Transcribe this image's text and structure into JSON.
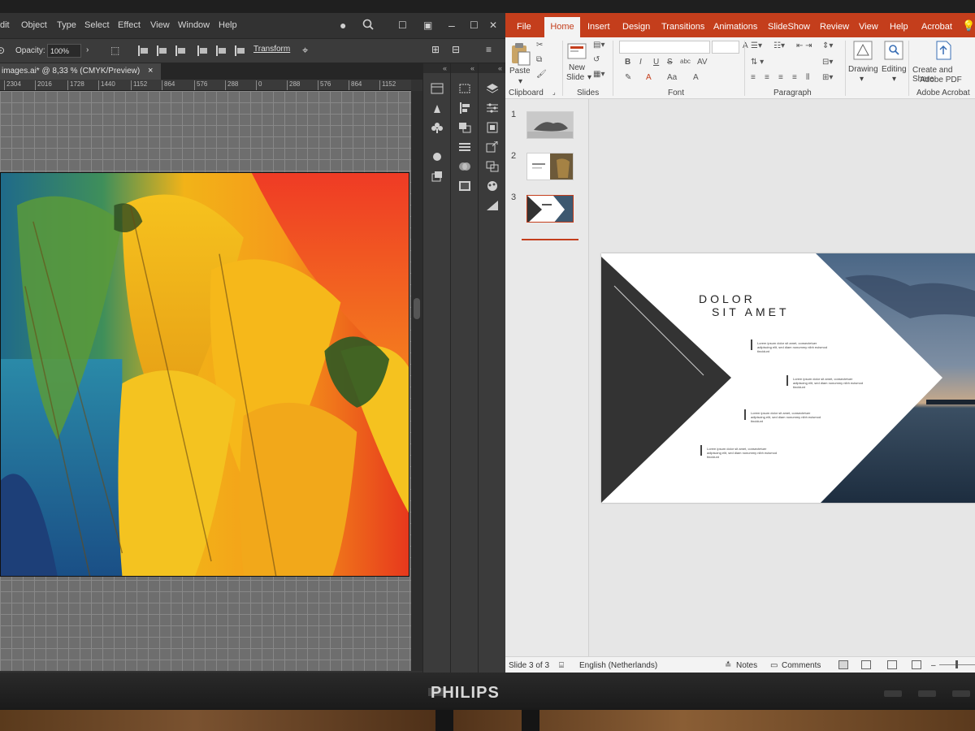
{
  "illustrator": {
    "menu": [
      "dit",
      "Object",
      "Type",
      "Select",
      "Effect",
      "View",
      "Window",
      "Help"
    ],
    "opacity_label": "Opacity:",
    "opacity_value": "100%",
    "transform_label": "Transform",
    "doc_tab": "images.ai* @ 8,33 % (CMYK/Preview)",
    "doc_tab_close": "×",
    "ruler": [
      "2304",
      "2016",
      "1728",
      "1440",
      "1152",
      "864",
      "576",
      "288",
      "0",
      "288",
      "576",
      "864",
      "1152"
    ],
    "window_controls": [
      "–",
      "☐",
      "✕"
    ],
    "panel_collapse": "«"
  },
  "powerpoint": {
    "tabs": [
      "File",
      "Home",
      "Insert",
      "Design",
      "Transitions",
      "Animations",
      "SlideShow",
      "Review",
      "View",
      "Help",
      "Acrobat"
    ],
    "active_tab": "Home",
    "ribbon": {
      "paste": "Paste",
      "new_slide": "New",
      "new_slide_2": "Slide",
      "drawing": "Drawing",
      "editing": "Editing",
      "create_share": "Create and Share",
      "create_share_2": "Adobe PDF",
      "groups": [
        "Clipboard",
        "Slides",
        "Font",
        "Paragraph",
        "Adobe Acrobat"
      ],
      "font_buttons": [
        "B",
        "I",
        "U",
        "S",
        "abc",
        "AV",
        "A",
        "Aa",
        "A"
      ]
    },
    "thumbnails": [
      "1",
      "2",
      "3"
    ],
    "slide": {
      "title_line_1": "DOLOR",
      "title_line_2": "SIT AMET",
      "body_1": "Lorem ipsum dolor sit amet, consectetuer adipiscing elit, sed diam nonummy nibh euismod tincidunt",
      "body_2": "Lorem ipsum dolor sit amet, consectetuer adipiscing elit, sed diam nonummy nibh euismod tincidunt",
      "body_3": "Lorem ipsum dolor sit amet, consectetuer adipiscing elit, sed diam nonummy nibh euismod tincidunt",
      "body_4": "Lorem ipsum dolor sit amet, consectetuer adipiscing elit, sed diam nonummy nibh euismod tincidunt"
    },
    "status": {
      "slide_of": "Slide 3 of 3",
      "language": "English (Netherlands)",
      "notes": "Notes",
      "comments": "Comments"
    },
    "accent": "#c43e1c"
  },
  "monitor": {
    "brand": "PHILIPS"
  }
}
